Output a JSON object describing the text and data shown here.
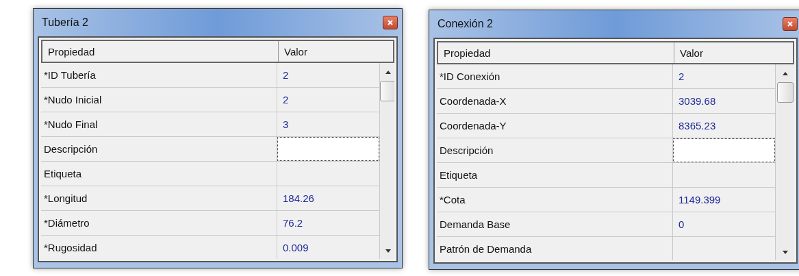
{
  "windows": [
    {
      "title": "Tubería 2",
      "columns": [
        "Propiedad",
        "Valor"
      ],
      "rows": [
        {
          "property": "*ID Tubería",
          "value": "2",
          "editing": false
        },
        {
          "property": "*Nudo Inicial",
          "value": "2",
          "editing": false
        },
        {
          "property": "*Nudo Final",
          "value": "3",
          "editing": false
        },
        {
          "property": "Descripción",
          "editing": true
        },
        {
          "property": "Etiqueta",
          "editing": false
        },
        {
          "property": "*Longitud",
          "value": "184.26",
          "editing": false
        },
        {
          "property": "*Diámetro",
          "value": "76.2",
          "editing": false
        },
        {
          "property": "*Rugosidad",
          "value": "0.009",
          "editing": false
        }
      ]
    },
    {
      "title": "Conexión 2",
      "columns": [
        "Propiedad",
        "Valor"
      ],
      "rows": [
        {
          "property": "*ID Conexión",
          "value": "2",
          "editing": false
        },
        {
          "property": "Coordenada-X",
          "value": "3039.68",
          "editing": false
        },
        {
          "property": "Coordenada-Y",
          "value": "8365.23",
          "editing": false
        },
        {
          "property": "Descripción",
          "editing": true
        },
        {
          "property": "Etiqueta",
          "editing": false
        },
        {
          "property": "*Cota",
          "value": "1149.399",
          "editing": false
        },
        {
          "property": "Demanda Base",
          "value": "0",
          "editing": false
        },
        {
          "property": "Patrón de Demanda",
          "editing": false
        }
      ]
    }
  ]
}
